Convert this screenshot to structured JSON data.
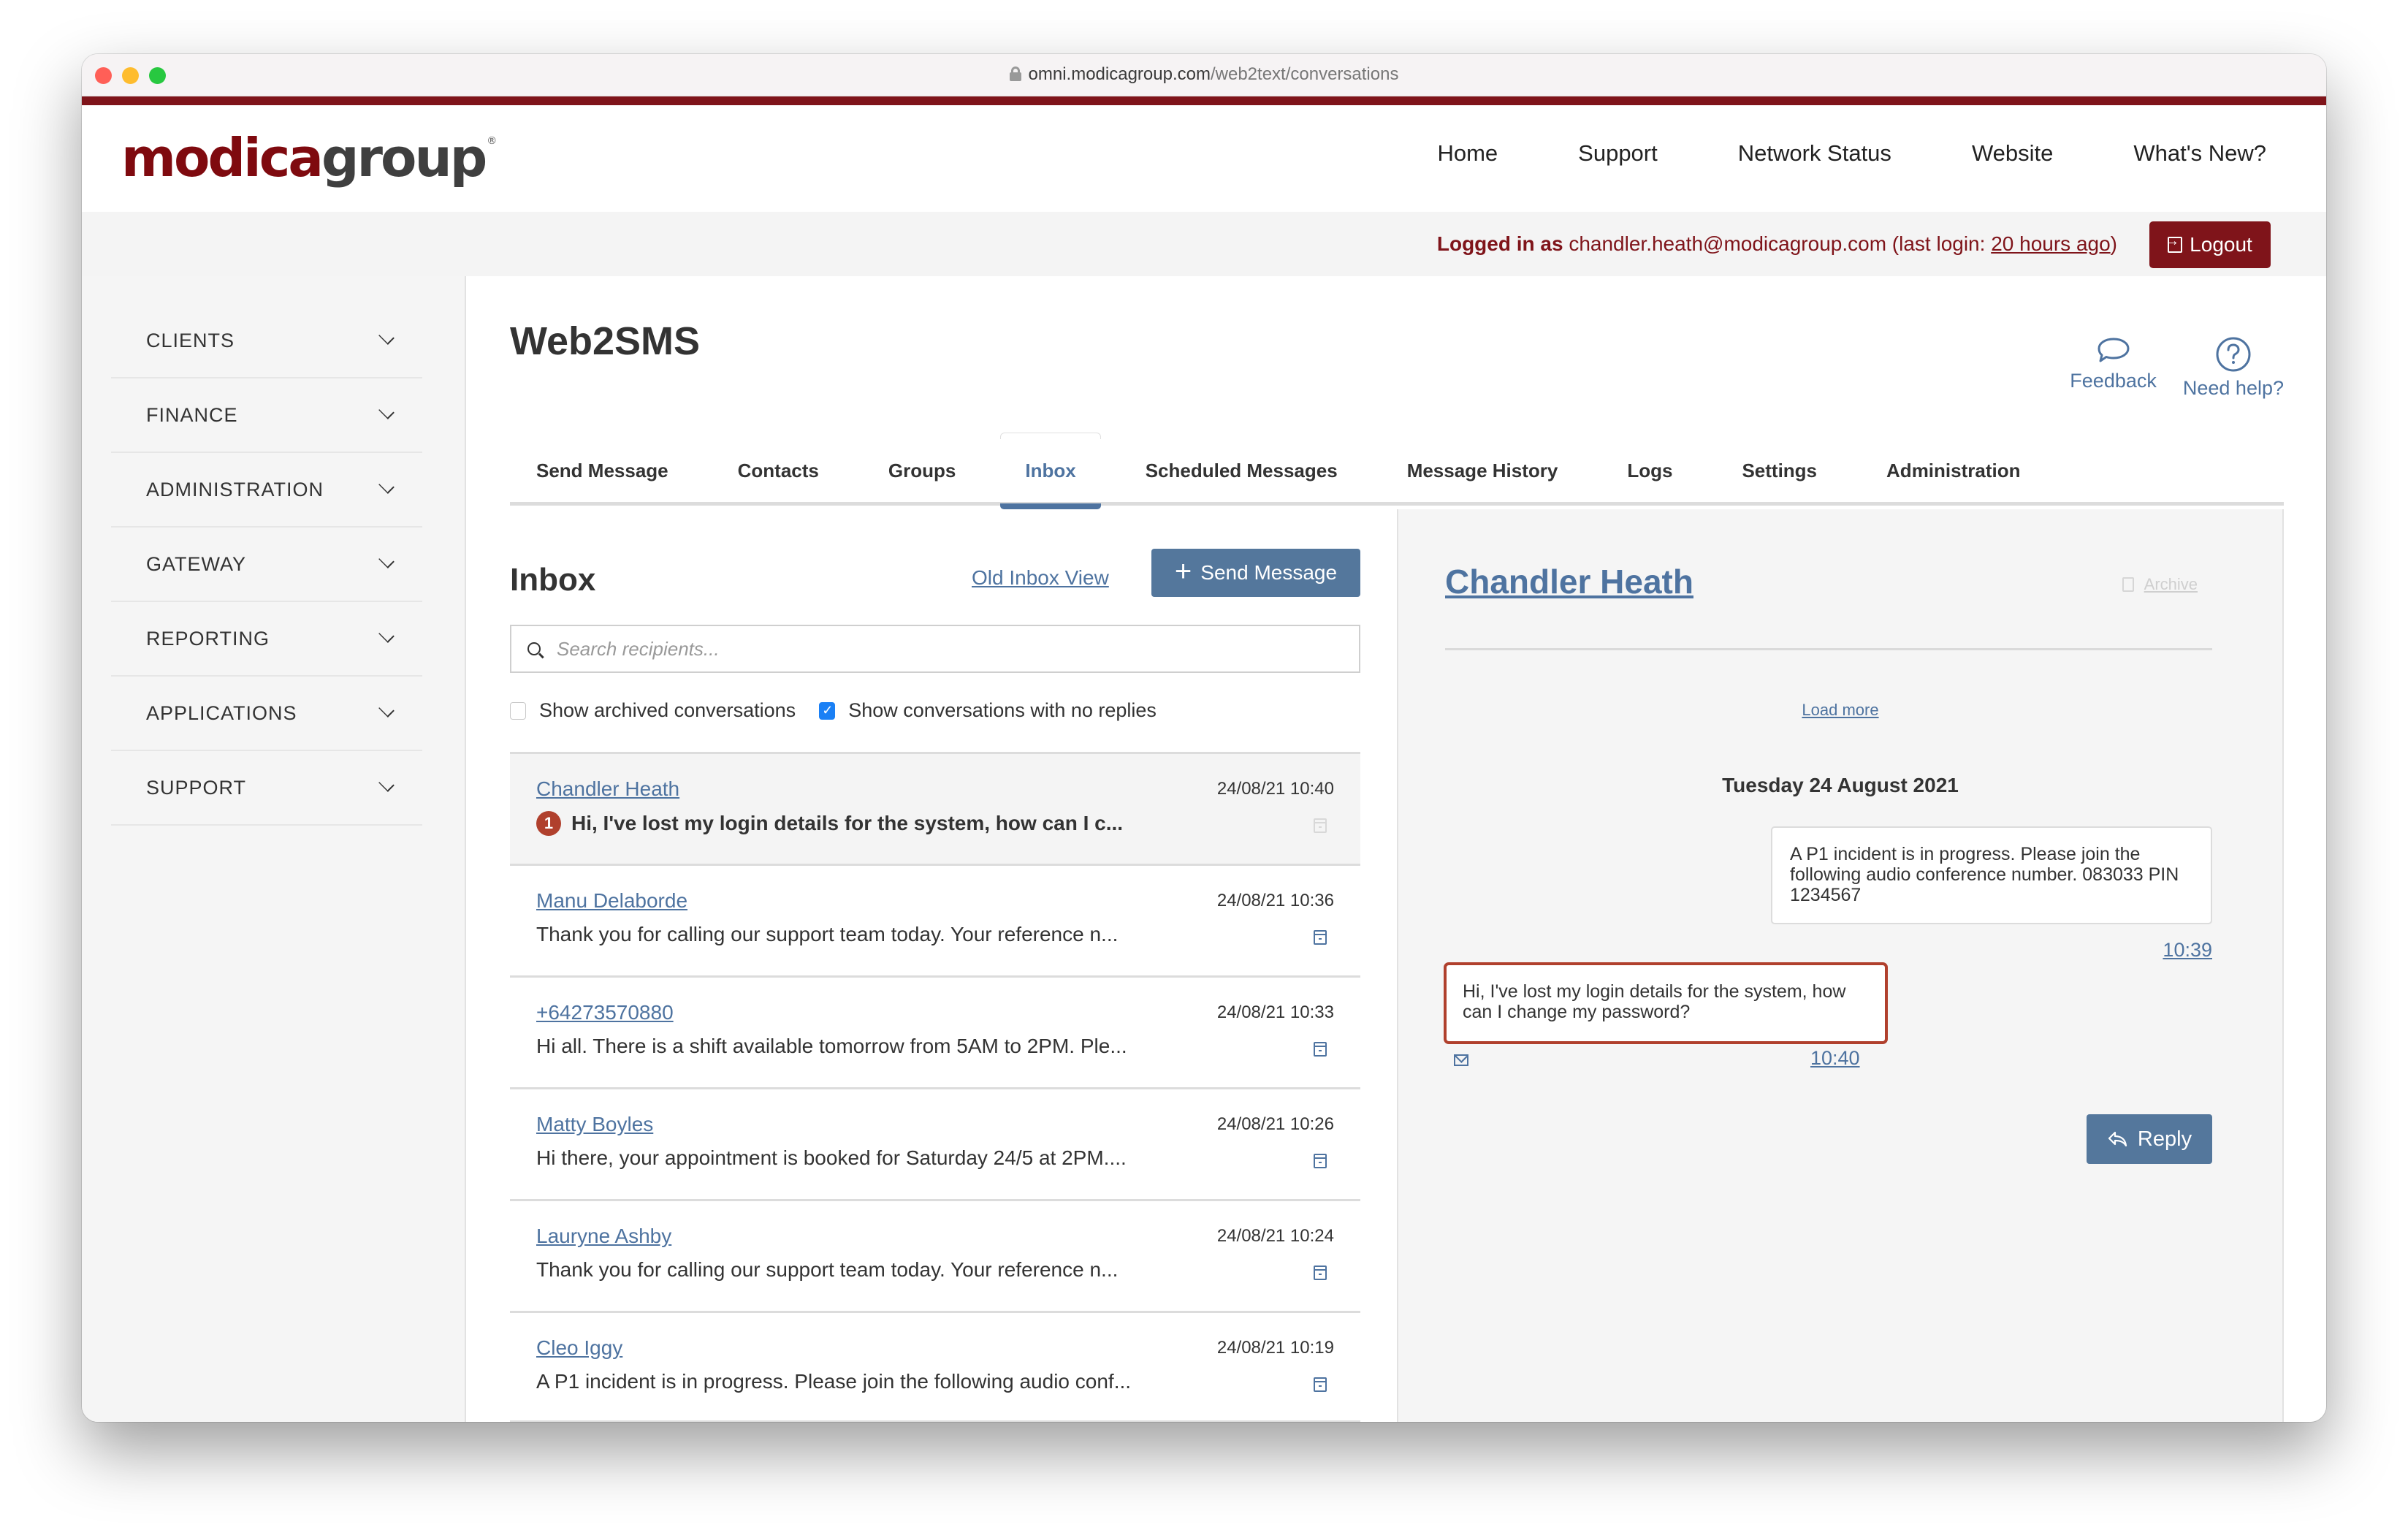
{
  "browser": {
    "url_host": "omni.modicagroup.com",
    "url_path": "/web2text/conversations"
  },
  "header": {
    "logo_primary": "modica",
    "logo_secondary": "group",
    "logo_mark": "®",
    "nav": [
      {
        "label": "Home"
      },
      {
        "label": "Support"
      },
      {
        "label": "Network Status"
      },
      {
        "label": "Website"
      },
      {
        "label": "What's New?"
      }
    ]
  },
  "login": {
    "prefix": "Logged in as",
    "email": "chandler.heath@modicagroup.com",
    "last_login_prefix": "(last login:",
    "last_login_value": "20 hours ago",
    "last_login_suffix": ")",
    "logout_label": "Logout"
  },
  "sidebar": {
    "items": [
      {
        "label": "CLIENTS"
      },
      {
        "label": "FINANCE"
      },
      {
        "label": "ADMINISTRATION"
      },
      {
        "label": "GATEWAY"
      },
      {
        "label": "REPORTING"
      },
      {
        "label": "APPLICATIONS"
      },
      {
        "label": "SUPPORT"
      }
    ]
  },
  "page": {
    "title": "Web2SMS",
    "feedback_label": "Feedback",
    "help_label": "Need help?",
    "tabs": [
      {
        "label": "Send Message",
        "active": false
      },
      {
        "label": "Contacts",
        "active": false
      },
      {
        "label": "Groups",
        "active": false
      },
      {
        "label": "Inbox",
        "active": true
      },
      {
        "label": "Scheduled Messages",
        "active": false
      },
      {
        "label": "Message History",
        "active": false
      },
      {
        "label": "Logs",
        "active": false
      },
      {
        "label": "Settings",
        "active": false
      },
      {
        "label": "Administration",
        "active": false
      }
    ]
  },
  "inbox": {
    "title": "Inbox",
    "old_view_label": "Old Inbox View",
    "send_label": "Send Message",
    "search_placeholder": "Search recipients...",
    "show_archived_label": "Show archived conversations",
    "show_archived_checked": false,
    "show_no_replies_label": "Show conversations with no replies",
    "show_no_replies_checked": true,
    "conversations": [
      {
        "name": "Chandler Heath",
        "time": "24/08/21 10:40",
        "preview": "Hi, I've lost my login details for the system, how can I c...",
        "unread": "1",
        "selected": true
      },
      {
        "name": "Manu Delaborde",
        "time": "24/08/21 10:36",
        "preview": "Thank you for calling our support team today. Your reference n...",
        "unread": null,
        "selected": false
      },
      {
        "name": "+64273570880",
        "time": "24/08/21 10:33",
        "preview": "Hi all. There is a shift available tomorrow from 5AM to 2PM. Ple...",
        "unread": null,
        "selected": false
      },
      {
        "name": "Matty Boyles",
        "time": "24/08/21 10:26",
        "preview": "Hi there, your appointment is booked for Saturday 24/5 at 2PM....",
        "unread": null,
        "selected": false
      },
      {
        "name": "Lauryne Ashby",
        "time": "24/08/21 10:24",
        "preview": "Thank you for calling our support team today. Your reference n...",
        "unread": null,
        "selected": false
      },
      {
        "name": "Cleo Iggy",
        "time": "24/08/21 10:19",
        "preview": "A P1 incident is in progress. Please join the following audio conf...",
        "unread": null,
        "selected": false
      }
    ]
  },
  "thread": {
    "contact_name": "Chandler Heath",
    "archive_label": "Archive",
    "load_more_label": "Load more",
    "day_label": "Tuesday 24 August 2021",
    "outgoing": {
      "text": "A P1 incident is in progress. Please join the following audio conference number. 083033 PIN 1234567",
      "time": "10:39"
    },
    "incoming": {
      "text": "Hi, I've lost my login details for the system, how can I change my password?",
      "time": "10:40"
    },
    "reply_label": "Reply"
  },
  "colors": {
    "brand_red": "#7f141a",
    "link_blue": "#4e73a0",
    "button_blue": "#54779c",
    "unread_red": "#b0402d"
  }
}
